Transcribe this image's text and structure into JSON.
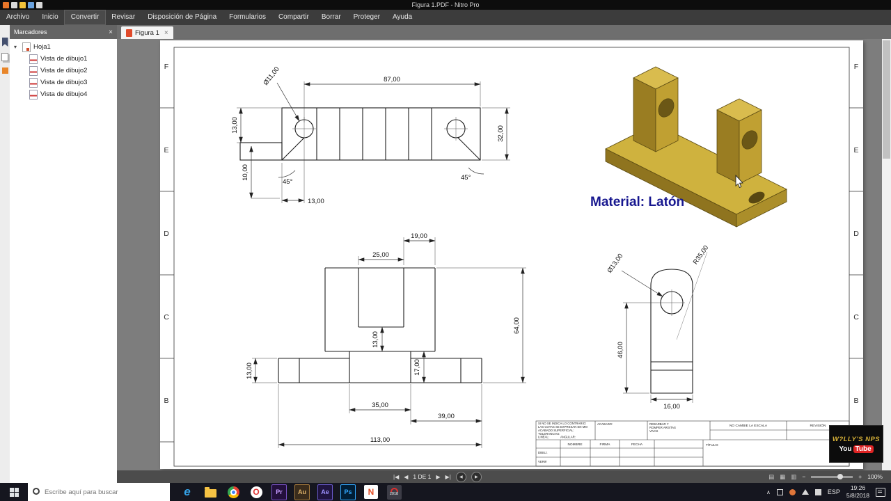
{
  "window": {
    "title": "Figura 1.PDF - Nitro Pro"
  },
  "menu": {
    "items": [
      "Archivo",
      "Inicio",
      "Convertir",
      "Revisar",
      "Disposición de Página",
      "Formularios",
      "Compartir",
      "Borrar",
      "Proteger",
      "Ayuda"
    ]
  },
  "panel": {
    "title": "Marcadores",
    "root": "Hoja1",
    "items": [
      "Vista de dibujo1",
      "Vista de dibujo2",
      "Vista de dibujo3",
      "Vista de dibujo4"
    ]
  },
  "tab": {
    "label": "Figura 1"
  },
  "icons": {
    "close": "×",
    "expander": "▾",
    "chevron_up": "∧"
  },
  "nav": {
    "first": "|◀",
    "prev": "◀",
    "page": "1 DE 1",
    "next": "▶",
    "last": "▶|",
    "back": "◀",
    "fwd": "▶"
  },
  "zoom": {
    "minus": "−",
    "plus": "+",
    "value": "100%"
  },
  "drawing": {
    "zones": [
      "F",
      "E",
      "D",
      "C",
      "B"
    ],
    "material": "Material: Latón",
    "dims": {
      "d87": "87,00",
      "d11": "Ø11,00",
      "d13a": "13,00",
      "d32": "32,00",
      "d10": "10,00",
      "d45l": "45°",
      "d45r": "45°",
      "d13b": "13,00",
      "d19": "19,00",
      "d25": "25,00",
      "d13c": "13,00",
      "d17": "17,00",
      "d64": "64,00",
      "d13d": "13,00",
      "d35": "35,00",
      "d39": "39,00",
      "d113": "113,00",
      "d13e": "Ø13,00",
      "dr35": "R35,00",
      "d46": "46,00",
      "d16": "16,00"
    },
    "title_block": {
      "note_lines": [
        "SI NO SE INDICA LO CONTRARIO:",
        "LAS COTAS SE EXPRESAN EN MM",
        "ACABADO SUPERFICIAL:",
        "TOLERANCIAS:",
        "   LINEAL:",
        "   ANGULAR:"
      ],
      "acabado": "ACABADO:",
      "deburr_lines": [
        "REBARBAR Y",
        "ROMPER ARISTAS",
        "VIVAS"
      ],
      "no_scale": "NO CAMBIE LA ESCALA",
      "revision": "REVISIÓN",
      "nombre": "NOMBRE",
      "firma": "FIRMA",
      "fecha": "FECHA",
      "titulo": "TÍTULO:",
      "rows": [
        "DIBUJ.",
        "VERIF."
      ]
    }
  },
  "taskbar": {
    "search_placeholder": "Escribe aquí para buscar",
    "app_labels": {
      "edge": "e",
      "opera": "O",
      "premiere": "Pr",
      "audition": "Au",
      "after_effects": "Ae",
      "photoshop": "Ps",
      "nitro": "N",
      "solidworks": "2018"
    },
    "tray": {
      "lang": "ESP",
      "time": "19:26",
      "date": "5/8/2018"
    }
  },
  "watermark": {
    "title": "W?LLY'S NPS",
    "you": "You",
    "tube": "Tube"
  }
}
